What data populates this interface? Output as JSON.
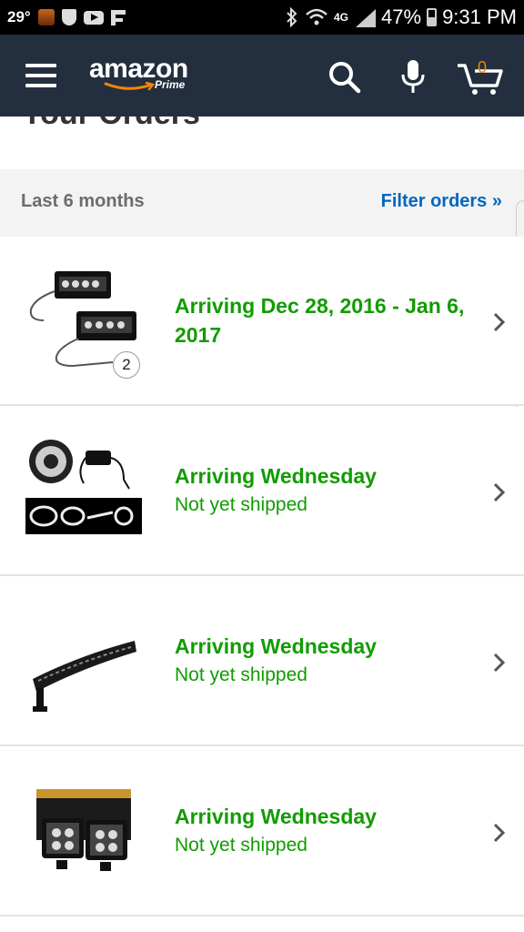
{
  "status_bar": {
    "temperature": "29°",
    "network": "4G",
    "battery": "47%",
    "time": "9:31 PM"
  },
  "header": {
    "logo_text": "amazon",
    "logo_sub": "Prime",
    "cart_count": "0"
  },
  "page": {
    "title_partial": "Your Orders"
  },
  "filter": {
    "period_label": "Last 6 months",
    "filter_link": "Filter orders »"
  },
  "orders": [
    {
      "arrival": "Arriving Dec 28, 2016 - Jan 6, 2017",
      "status": "",
      "quantity": "2",
      "image": "led-light-pods-pair"
    },
    {
      "arrival": "Arriving Wednesday",
      "status": "Not yet shipped",
      "quantity": "",
      "image": "led-strip-kit"
    },
    {
      "arrival": "Arriving Wednesday",
      "status": "Not yet shipped",
      "quantity": "",
      "image": "curved-light-bar"
    },
    {
      "arrival": "Arriving Wednesday",
      "status": "Not yet shipped",
      "quantity": "",
      "image": "led-pods-boxed"
    }
  ],
  "colors": {
    "header_bg": "#232f3e",
    "accent_green": "#119c00",
    "link_blue": "#0066c0",
    "cart_orange": "#f08804"
  }
}
